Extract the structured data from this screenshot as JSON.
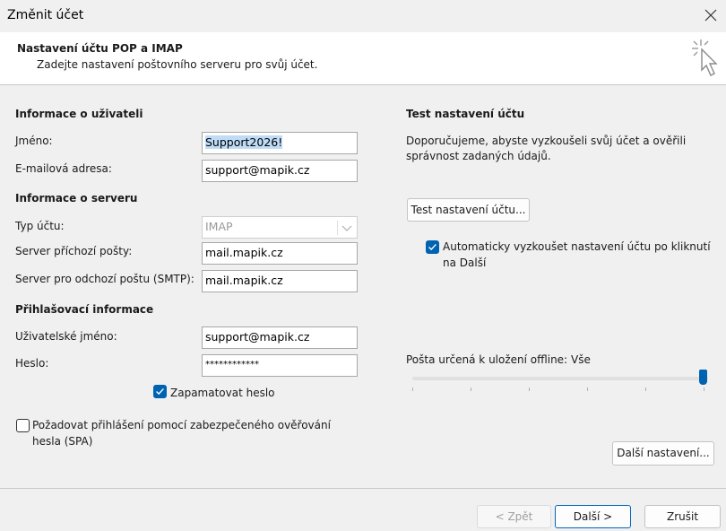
{
  "window": {
    "title": "Změnit účet"
  },
  "header": {
    "title": "Nastavení účtu POP a IMAP",
    "subtitle": "Zadejte nastavení poštovního serveru pro svůj účet."
  },
  "user_info": {
    "section": "Informace o uživateli",
    "name_label": "Jméno:",
    "name_value": "Support2026!",
    "email_label": "E-mailová adresa:",
    "email_value": "support@mapik.cz"
  },
  "server_info": {
    "section": "Informace o serveru",
    "type_label": "Typ účtu:",
    "type_value": "IMAP",
    "incoming_label": "Server příchozí pošty:",
    "incoming_value": "mail.mapik.cz",
    "outgoing_label": "Server pro odchozí poštu (SMTP):",
    "outgoing_value": "mail.mapik.cz"
  },
  "login_info": {
    "section": "Přihlašovací informace",
    "username_label": "Uživatelské jméno:",
    "username_value": "support@mapik.cz",
    "password_label": "Heslo:",
    "password_value": "************",
    "remember_label": "Zapamatovat heslo",
    "remember_checked": true,
    "spa_label_line1": "Požadovat přihlášení pomocí zabezpečeného ověřování",
    "spa_label_line2": "hesla (SPA)",
    "spa_checked": false
  },
  "test": {
    "section": "Test nastavení účtu",
    "desc_line1": "Doporučujeme, abyste vyzkoušeli svůj účet a ověřili",
    "desc_line2": "správnost zadaných údajů.",
    "button": "Test nastavení účtu...",
    "auto_label_line1": "Automaticky vyzkoušet nastavení účtu po kliknutí",
    "auto_label_line2": "na Další",
    "auto_checked": true
  },
  "offline": {
    "label": "Pošta určená k uložení offline:",
    "value": "Vše",
    "slider_level": 1.0
  },
  "more_settings_button": "Další nastavení...",
  "footer": {
    "back": "< Zpět",
    "next": "Další >",
    "cancel": "Zrušit"
  },
  "colors": {
    "accent": "#0063b1",
    "selection": "#bfdcf7"
  },
  "icons": [
    "close-icon",
    "cursor-click-icon",
    "checkmark-icon",
    "chevron-down-icon"
  ]
}
